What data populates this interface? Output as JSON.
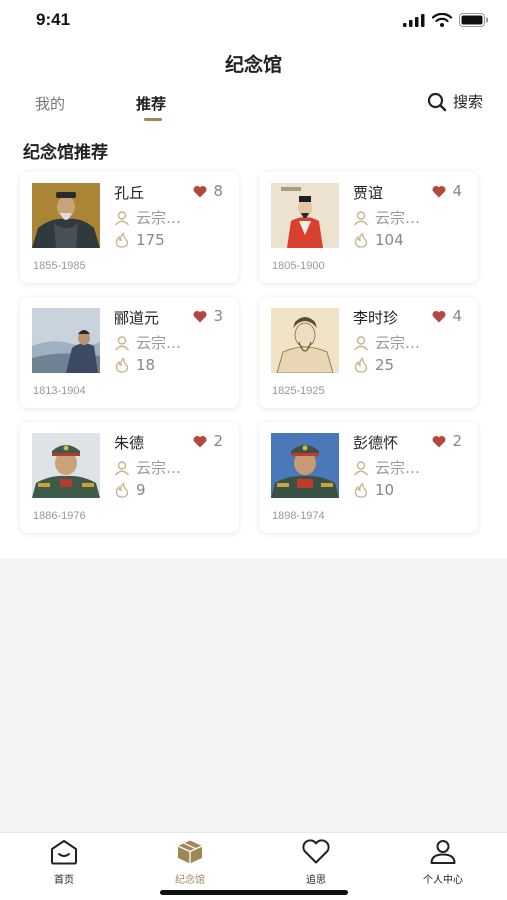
{
  "status_bar": {
    "time": "9:41"
  },
  "header": {
    "title": "纪念馆"
  },
  "tabs": [
    {
      "label": "我的",
      "active": false
    },
    {
      "label": "推荐",
      "active": true
    }
  ],
  "search": {
    "label": "搜索",
    "icon": "search-icon"
  },
  "section": {
    "title": "纪念馆推荐"
  },
  "cards": [
    {
      "name": "孔丘",
      "likes": "8",
      "author": "云宗…",
      "views": "175",
      "years": "1855-1985",
      "portrait": "confucius-portrait"
    },
    {
      "name": "贾谊",
      "likes": "4",
      "author": "云宗…",
      "views": "104",
      "years": "1805-1900",
      "portrait": "jiayi-portrait"
    },
    {
      "name": "郦道元",
      "likes": "3",
      "author": "云宗…",
      "views": "18",
      "years": "1813-1904",
      "portrait": "lidaoyuan-portrait"
    },
    {
      "name": "李时珍",
      "likes": "4",
      "author": "云宗…",
      "views": "25",
      "years": "1825-1925",
      "portrait": "lishizhen-portrait"
    },
    {
      "name": "朱德",
      "likes": "2",
      "author": "云宗…",
      "views": "9",
      "years": "1886-1976",
      "portrait": "zhude-portrait"
    },
    {
      "name": "彭德怀",
      "likes": "2",
      "author": "云宗…",
      "views": "10",
      "years": "1898-1974",
      "portrait": "pengdehuai-portrait"
    }
  ],
  "bottom_nav": [
    {
      "label": "首页",
      "icon": "home-icon",
      "active": false
    },
    {
      "label": "纪念馆",
      "icon": "memorial-box-icon",
      "active": true
    },
    {
      "label": "追思",
      "icon": "heart-icon",
      "active": false
    },
    {
      "label": "个人中心",
      "icon": "person-icon",
      "active": false
    }
  ],
  "colors": {
    "accent": "#a08757",
    "heart": "#b5473f",
    "background": "#f4f4f4"
  }
}
